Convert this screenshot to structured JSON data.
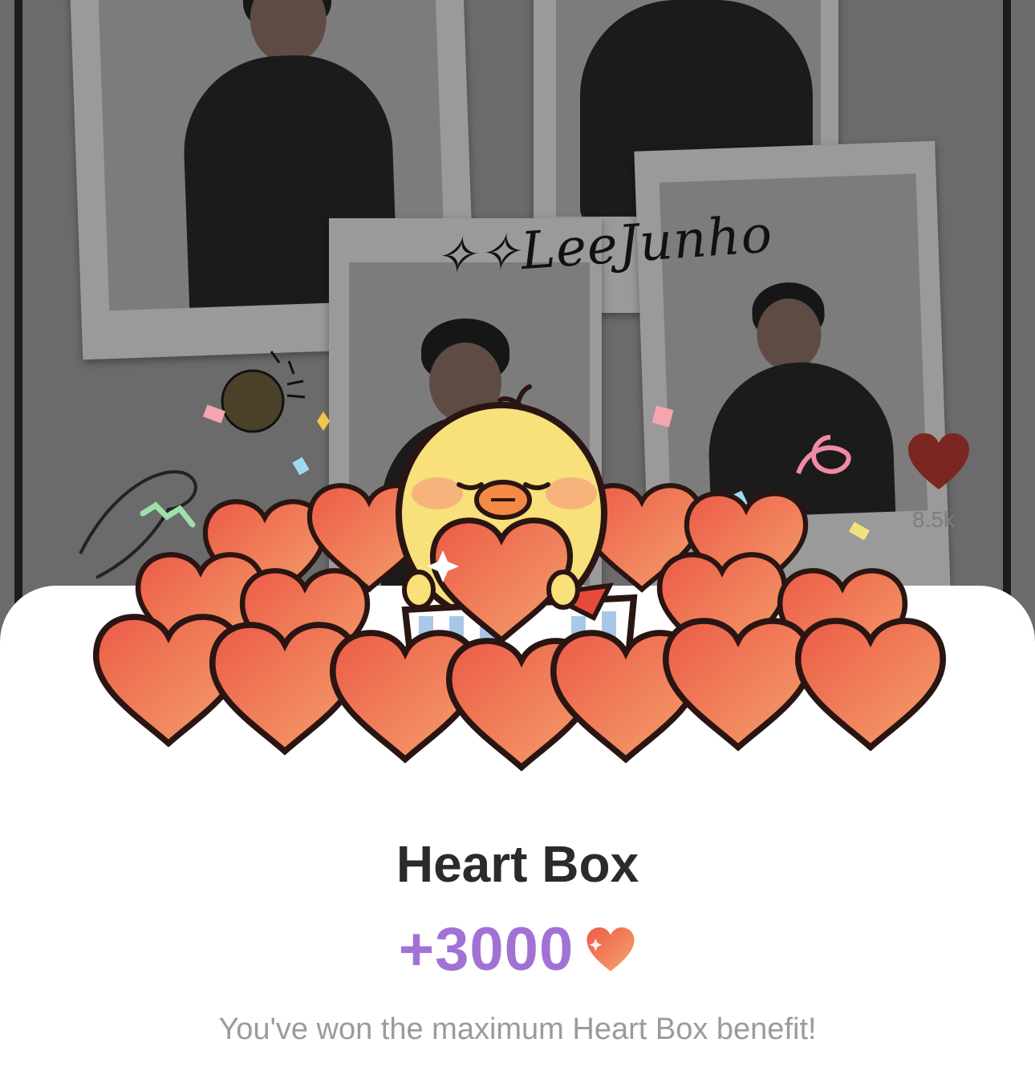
{
  "post": {
    "signature": "✧✧LeeJunho",
    "like_count": "8.5k",
    "like_icon": "heart-icon"
  },
  "sheet": {
    "title": "Heart Box",
    "reward_amount": "+3000",
    "reward_icon": "heart-icon",
    "message": "You've won the maximum Heart Box benefit!"
  },
  "colors": {
    "accent_purple": "#a172d4",
    "heart_top": "#ec5d49",
    "heart_bottom": "#f39c6b",
    "chick_yellow": "#f8e07a"
  }
}
